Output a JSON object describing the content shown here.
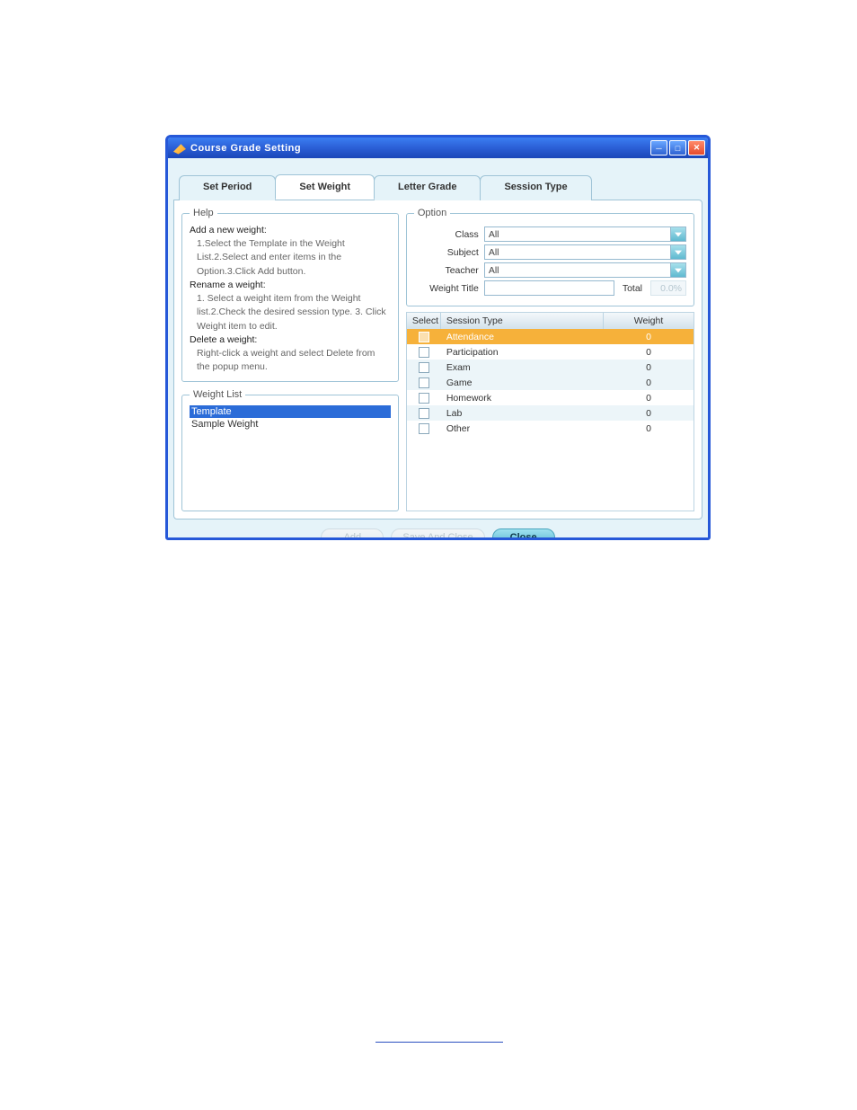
{
  "window": {
    "title": "Course Grade Setting"
  },
  "tabs": [
    {
      "label": "Set Period"
    },
    {
      "label": "Set Weight"
    },
    {
      "label": "Letter Grade"
    },
    {
      "label": "Session Type"
    }
  ],
  "help": {
    "legend": "Help",
    "add_h": "Add a new weight:",
    "add_s": "1.Select the Template in the Weight List.2.Select and enter items in the Option.3.Click Add button.",
    "ren_h": "Rename a weight:",
    "ren_s": "1. Select a weight item from the Weight list.2.Check the desired session type. 3. Click Weight item to edit.",
    "del_h": "Delete a weight:",
    "del_s": "Right-click a weight and select Delete from the popup menu."
  },
  "weightlist": {
    "legend": "Weight List",
    "items": [
      "Template",
      "Sample Weight"
    ]
  },
  "option": {
    "legend": "Option",
    "class_l": "Class",
    "class_v": "All",
    "subject_l": "Subject",
    "subject_v": "All",
    "teacher_l": "Teacher",
    "teacher_v": "All",
    "wtitle_l": "Weight Title",
    "wtitle_v": "",
    "total_l": "Total",
    "total_v": "0.0%"
  },
  "table": {
    "h_select": "Select",
    "h_type": "Session Type",
    "h_weight": "Weight",
    "rows": [
      {
        "type": "Attendance",
        "weight": "0"
      },
      {
        "type": "Participation",
        "weight": "0"
      },
      {
        "type": "Exam",
        "weight": "0"
      },
      {
        "type": "Game",
        "weight": "0"
      },
      {
        "type": "Homework",
        "weight": "0"
      },
      {
        "type": "Lab",
        "weight": "0"
      },
      {
        "type": "Other",
        "weight": "0"
      }
    ]
  },
  "buttons": {
    "add": "Add",
    "save": "Save And Close",
    "close": "Close"
  }
}
